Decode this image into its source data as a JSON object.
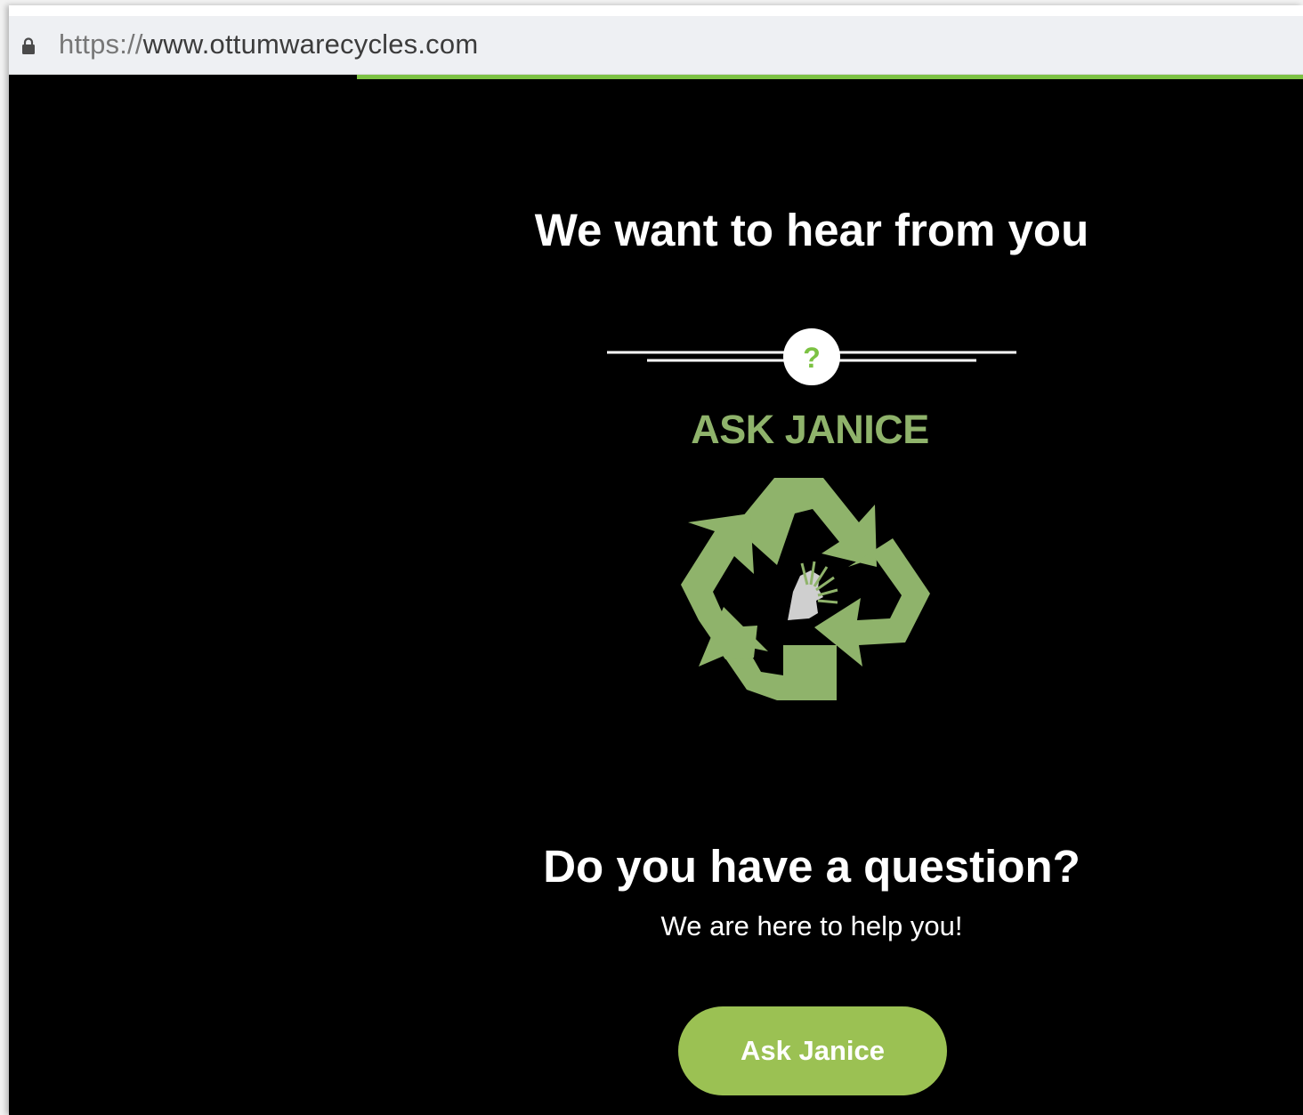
{
  "browser": {
    "url_scheme": "https://",
    "url_host": "www.ottumwarecycles.com",
    "icons": {
      "lock": "lock-icon"
    },
    "progress_color": "#7cc243"
  },
  "page": {
    "heading": "We want to hear from you",
    "divider_badge": "?",
    "logo_title": "ASK JANICE",
    "question": "Do you have a question?",
    "subtext": "We are here to help you!",
    "cta_label": "Ask Janice"
  },
  "colors": {
    "background": "#000000",
    "accent": "#9bc153",
    "logo_green": "#8fb36b",
    "text": "#ffffff"
  },
  "icons": {
    "badge": "question-mark-icon",
    "logo": "recycle-icon"
  }
}
